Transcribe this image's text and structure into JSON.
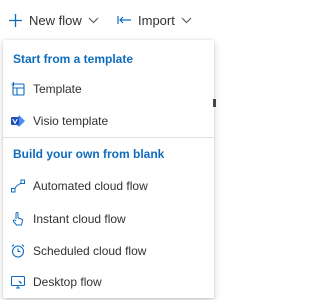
{
  "toolbar": {
    "new_flow_label": "New flow",
    "import_label": "Import"
  },
  "menu": {
    "group_template_header": "Start from a template",
    "group_blank_header": "Build your own from blank",
    "items": [
      {
        "label": "Template",
        "icon": "template-icon"
      },
      {
        "label": "Visio template",
        "icon": "visio-icon"
      },
      {
        "label": "Automated cloud flow",
        "icon": "automated-flow-icon"
      },
      {
        "label": "Instant cloud flow",
        "icon": "instant-flow-icon"
      },
      {
        "label": "Scheduled cloud flow",
        "icon": "scheduled-flow-icon"
      },
      {
        "label": "Desktop flow",
        "icon": "desktop-flow-icon"
      }
    ]
  },
  "colors": {
    "accent": "#0f6cbd",
    "text": "#323130",
    "divider": "#e1dfdd"
  }
}
